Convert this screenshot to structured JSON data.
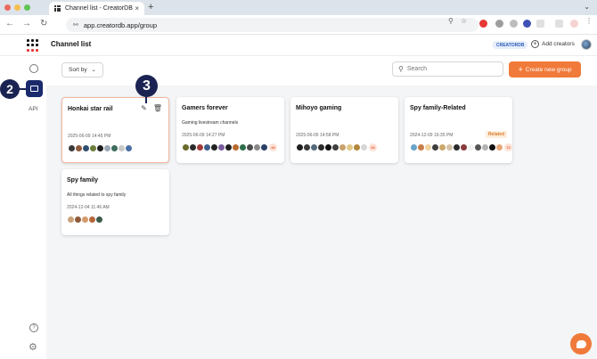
{
  "browser": {
    "tab_title": "Channel list - CreatorDB",
    "tab_close": "×",
    "new_tab": "+",
    "tab_menu": "⌄",
    "url": "app.creatordb.app/group",
    "back": "←",
    "forward": "→",
    "reload": "↻"
  },
  "header": {
    "title": "Channel list",
    "brand_badge": "CREATORDB",
    "add_creators": "Add creators"
  },
  "sidebar": {
    "api_label": "API",
    "help": "?",
    "settings": "⚙"
  },
  "annotations": {
    "step2": "2",
    "step3": "3"
  },
  "toolbar": {
    "sort_label": "Sort by",
    "search_placeholder": "Search",
    "create_label": "Create new group"
  },
  "colors": {
    "accent": "#f07a3a",
    "nav_active": "#1a2a6c",
    "related_badge": "#d97a2b"
  },
  "groups": [
    {
      "title": "Honkai star rail",
      "description": "",
      "date": "2025-06-09 14:45 PM",
      "more": "",
      "related": "",
      "avatars": [
        "#3a3a3a",
        "#8e5a3c",
        "#2f4f6f",
        "#6b7d3c",
        "#1d1d1d",
        "#9aa7b5",
        "#3d6e5c",
        "#c8c8c8",
        "#4a6fa5"
      ]
    },
    {
      "title": "Gamers forever",
      "description": "Gaming livestream channels",
      "date": "2025-06-09 14:27 PM",
      "more": "46",
      "related": "",
      "avatars": [
        "#6a6a2a",
        "#2b2b2b",
        "#a23b3b",
        "#3c5f8a",
        "#222222",
        "#7a5c9e",
        "#1f1f1f",
        "#b86b2e",
        "#2e6e4a",
        "#4b4b4b",
        "#8a8a8a",
        "#2a3f66"
      ]
    },
    {
      "title": "Mihoyo gaming",
      "description": "",
      "date": "2025-06-05 14:58 PM",
      "more": "26",
      "related": "",
      "avatars": [
        "#1f1f1f",
        "#3a3a3a",
        "#556b7d",
        "#2c2c2c",
        "#111111",
        "#404040",
        "#c9a26b",
        "#e0c98a",
        "#b3863c",
        "#d6d6d6"
      ]
    },
    {
      "title": "Spy family-Related",
      "description": "",
      "date": "2024-12-09 16:35 PM",
      "more": "72",
      "related": "Related",
      "avatars": [
        "#6aa4c8",
        "#c77d4a",
        "#f0d3a0",
        "#3e3e3e",
        "#caa86a",
        "#d4c3a8",
        "#2b2b2b",
        "#8a3b3b",
        "#f2f2f2",
        "#555555",
        "#b2b2b2",
        "#111111",
        "#e8a87c"
      ]
    },
    {
      "title": "Spy family",
      "description": "All things related to spy family",
      "date": "2024-12-04 11:46 AM",
      "more": "",
      "related": "",
      "avatars": [
        "#c8a27a",
        "#8d5a3b",
        "#d49a6a",
        "#b5673c",
        "#3d5a4a"
      ]
    }
  ]
}
